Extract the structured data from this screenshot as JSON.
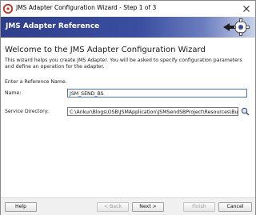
{
  "window": {
    "title": "JMS Adapter Configuration Wizard - Step 1 of 3",
    "close_glyph": "✕"
  },
  "banner": {
    "title": "JMS Adapter Reference"
  },
  "main": {
    "heading": "Welcome to the JMS Adapter Configuration Wizard",
    "description": "This wizard helps you create JMS Adapter. You will be asked to specify configuration parameters and define an operation for the adapter.",
    "prompt": "Enter a Reference Name.",
    "name_label": "Name:",
    "name_value": "JSM_SEND_BS",
    "dir_label": "Service Directory:",
    "dir_value": "C:\\Ankur\\Blogs\\OSB\\JSMApplication\\JSMSendSBProject\\Resources\\BusinessService"
  },
  "footer": {
    "help_label": "Help",
    "back_label": "< Back",
    "next_label": "Next >",
    "finish_label": "Finish",
    "cancel_label": "Cancel"
  },
  "colors": {
    "banner_start": "#2f3e8c",
    "banner_end": "#c9d2ea",
    "field_focus": "#4a73b6"
  },
  "icons": {
    "app": "oracle-adapter-icon",
    "close": "close-icon",
    "browse": "search-icon",
    "banner": "gear-icon"
  }
}
